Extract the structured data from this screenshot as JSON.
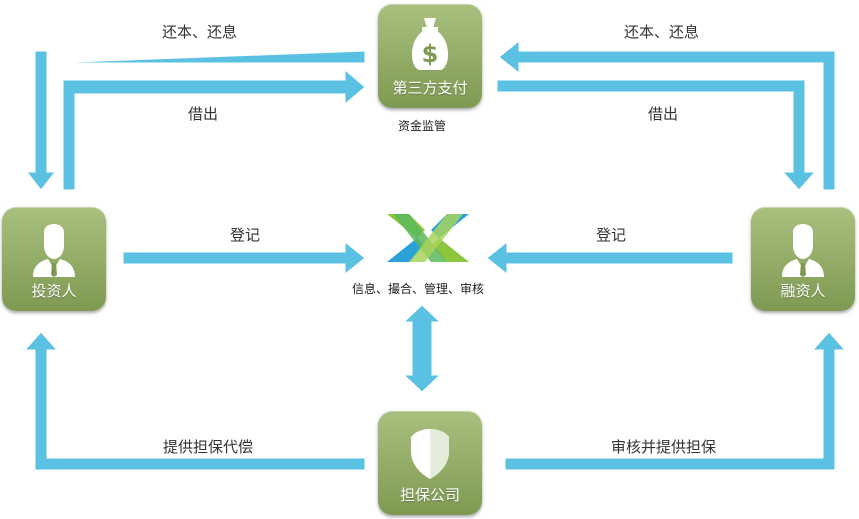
{
  "nodes": {
    "payment": "第三方支付",
    "investor": "投资人",
    "borrower": "融资人",
    "guarantor": "担保公司"
  },
  "labels": {
    "top_left_repay": "还本、还息",
    "top_right_repay": "还本、还息",
    "lend_left": "借出",
    "lend_right": "借出",
    "payment_sub": "资金监管",
    "register_left": "登记",
    "register_right": "登记",
    "platform_sub": "信息、撮合、管理、审核",
    "guarantee_left": "提供担保代偿",
    "guarantee_right": "审核并提供担保"
  },
  "colors": {
    "arrow": "#5bc1e3",
    "node": "#8fab62",
    "logo_green": "#8cc63f",
    "logo_blue": "#2aa1d9"
  },
  "icons": {
    "payment": "money-bag-icon",
    "investor": "person-icon",
    "borrower": "person-icon",
    "guarantor": "shield-icon",
    "platform": "platform-logo-icon"
  }
}
